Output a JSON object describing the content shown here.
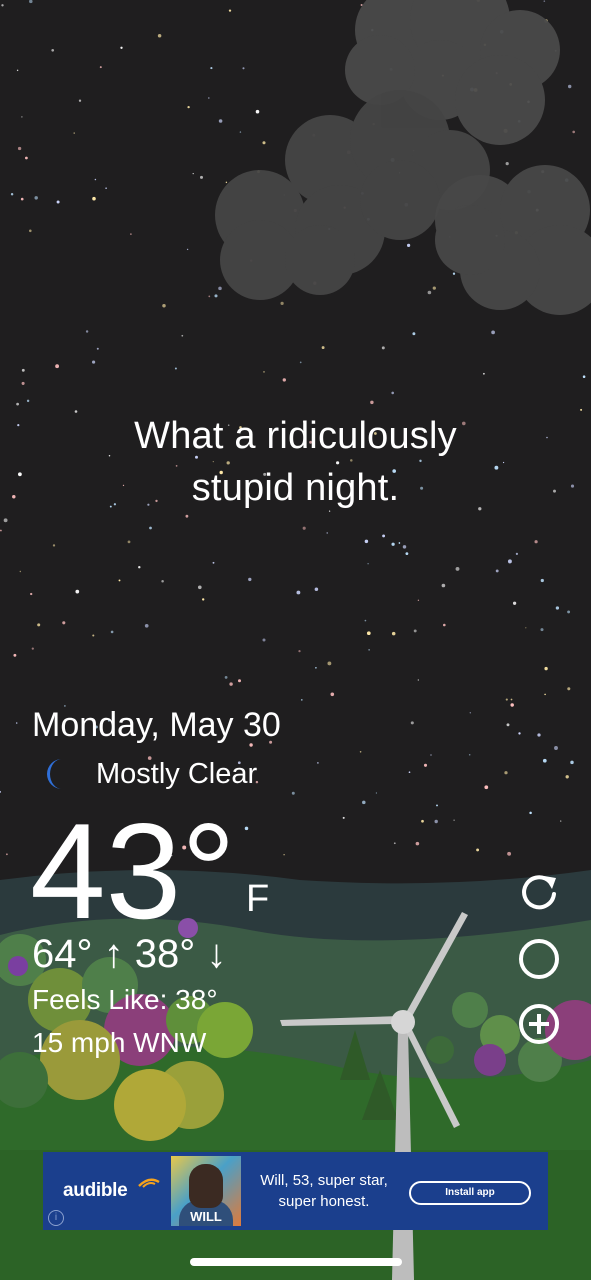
{
  "headline": {
    "line1": "What a ridiculously",
    "line2": "stupid night."
  },
  "weather": {
    "date": "Monday, May 30",
    "condition_icon": "crescent-moon-icon",
    "condition": "Mostly Clear",
    "temperature": "43°",
    "unit": "F",
    "high_low": "64° ↑ 38° ↓",
    "feels_like": "Feels Like: 38°",
    "wind": "15 mph WNW"
  },
  "side_buttons": [
    {
      "name": "refresh-icon"
    },
    {
      "name": "theme-toggle-icon"
    },
    {
      "name": "add-location-icon"
    }
  ],
  "ad": {
    "brand": "audible",
    "cover_title": "WILL",
    "text": "Will, 53, super star, super honest.",
    "cta": "Install app"
  },
  "colors": {
    "sky": "#1f1e1f",
    "moon": "#2f6fd8",
    "ad_background": "#1b3f8d",
    "grass": "#2f6a2a"
  }
}
